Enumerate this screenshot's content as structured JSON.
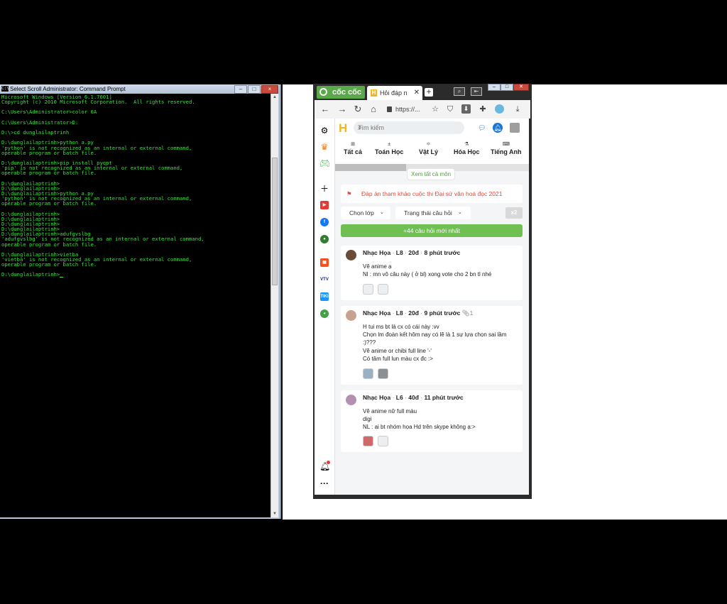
{
  "cmd": {
    "title": "Select Scroll Administrator: Command Prompt",
    "icon": "cmd-icon",
    "lines": [
      "Microsoft Windows [Version 6.1.7601]",
      "Copyright (c) 2010 Microsoft Corporation.  All rights reserved.",
      "",
      "C:\\Users\\Administrator>color 0A",
      "",
      "C:\\Users\\Administrator>D:",
      "",
      "D:\\>cd dunglailaptrinh",
      "",
      "D:\\dunglailaptrinh>python a.py",
      "'python' is not recognized as an internal or external command,",
      "operable program or batch file.",
      "",
      "D:\\dunglailaptrinh>pip install pyqpt",
      "'pip' is not recognized as an internal or external command,",
      "operable program or batch file.",
      "",
      "D:\\dunglailaptrinh>",
      "D:\\dunglailaptrinh>",
      "D:\\dunglailaptrinh>python a.py",
      "'python' is not recognized as an internal or external command,",
      "operable program or batch file.",
      "",
      "D:\\dunglailaptrinh>",
      "D:\\dunglailaptrinh>",
      "D:\\dunglailaptrinh>",
      "D:\\dunglailaptrinh>",
      "D:\\dunglailaptrinh>adufgvslbg",
      "'adufgvslbg' is not recognized as an internal or external command,",
      "operable program or batch file.",
      "",
      "D:\\dunglailaptrinh>vietba",
      "'vietba' is not recognized as an internal or external command,",
      "operable program or batch file.",
      "",
      "D:\\dunglailaptrinh>"
    ],
    "text_color": "#34e53a"
  },
  "browser": {
    "brand": "cốc cốc",
    "tab_title": "Hỏi đáp n",
    "tab_favicon": "H",
    "new_tab": "+",
    "url": "https://...",
    "accent": "#5aa84a"
  },
  "site": {
    "search_placeholder": "Tìm kiếm",
    "subjects": [
      {
        "label": "Tất cả",
        "icon": "grid-icon"
      },
      {
        "label": "Toán Học",
        "icon": "math-icon"
      },
      {
        "label": "Vật Lý",
        "icon": "physics-icon"
      },
      {
        "label": "Hóa Học",
        "icon": "chemistry-icon"
      },
      {
        "label": "Tiếng Anh",
        "icon": "english-icon"
      }
    ],
    "see_all": "Xem tất cả môn",
    "banner": "Đáp án tham khảo cuộc thi Đại sứ văn hoá đọc 2021",
    "filter_class": "Chọn lớp",
    "filter_status": "Trạng thái câu hỏi",
    "x2_badge": "x2",
    "new_questions": "+44 câu hỏi mới nhất",
    "posts": [
      {
        "author": "Nhạc Họa",
        "grade": "L8",
        "points": "20đ",
        "time": "8 phút trước",
        "attach": "",
        "lines": [
          "Vẽ anime ạ",
          "Nl : mn vô câu này ( ở bl) xong vote cho  2 bn tl nhé"
        ]
      },
      {
        "author": "Nhạc Họa",
        "grade": "L8",
        "points": "20đ",
        "time": "9 phút trước",
        "attach": "1",
        "lines": [
          "H tui ms bt là cx có cái này :vv",
          "Chọn lm đoàn kết hôm nay có lẽ là 1 sự lựa chọn sai lầm",
          ":)???",
          "Vẽ anime or chibi full line '-'",
          "Có tâm full lun màu cx đc :>"
        ]
      },
      {
        "author": "Nhạc Họa",
        "grade": "L6",
        "points": "40đ",
        "time": "11 phút trước",
        "attach": "",
        "lines": [
          "Vẽ anime nữ full màu",
          "digi",
          "NL : ai bt nhóm họa Hd trên skype không ạ:>"
        ]
      }
    ],
    "sidebar_badges": [
      "VTV",
      "TIKI"
    ]
  }
}
